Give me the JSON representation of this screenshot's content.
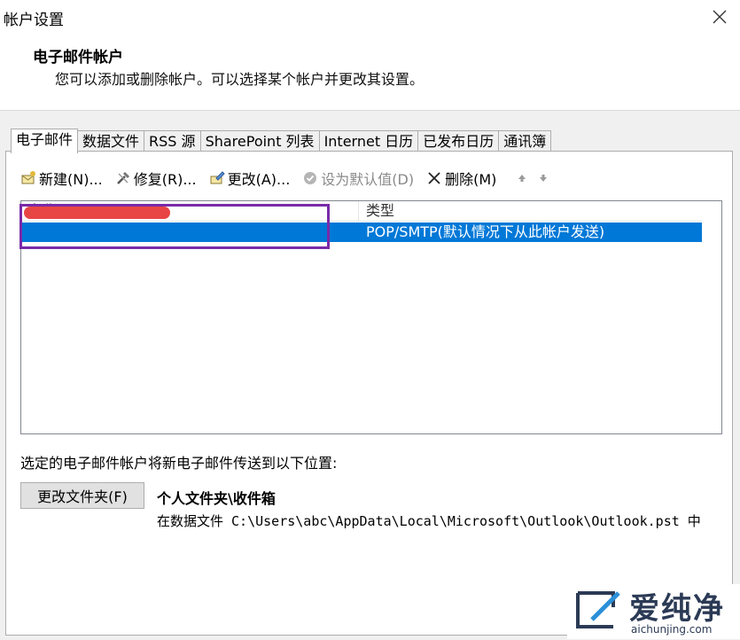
{
  "window": {
    "title": "帐户设置",
    "close_icon": "close-icon"
  },
  "header": {
    "title": "电子邮件帐户",
    "subtitle": "您可以添加或删除帐户。可以选择某个帐户并更改其设置。"
  },
  "tabs": [
    {
      "label": "电子邮件",
      "active": true
    },
    {
      "label": "数据文件",
      "active": false
    },
    {
      "label": "RSS 源",
      "active": false
    },
    {
      "label": "SharePoint 列表",
      "active": false
    },
    {
      "label": "Internet 日历",
      "active": false
    },
    {
      "label": "已发布日历",
      "active": false
    },
    {
      "label": "通讯簿",
      "active": false
    }
  ],
  "toolbar": {
    "new_label": "新建(N)...",
    "repair_label": "修复(R)...",
    "change_label": "更改(A)...",
    "default_label": "设为默认值(D)",
    "delete_label": "删除(M)"
  },
  "list": {
    "col_name": "名称",
    "col_type": "类型",
    "rows": [
      {
        "name": "",
        "type": "POP/SMTP(默认情况下从此帐户发送)"
      }
    ]
  },
  "delivery": {
    "label": "选定的电子邮件帐户将新电子邮件传送到以下位置:",
    "change_folder_button": "更改文件夹(F)",
    "folder": "个人文件夹\\收件箱",
    "data_file": "在数据文件 C:\\Users\\abc\\AppData\\Local\\Microsoft\\Outlook\\Outlook.pst 中"
  },
  "watermark": {
    "text": "爱纯净",
    "url": "aichunjing.com"
  },
  "colors": {
    "selection": "#0078d7",
    "highlight": "#7a2aa8",
    "redaction": "#e84545"
  }
}
